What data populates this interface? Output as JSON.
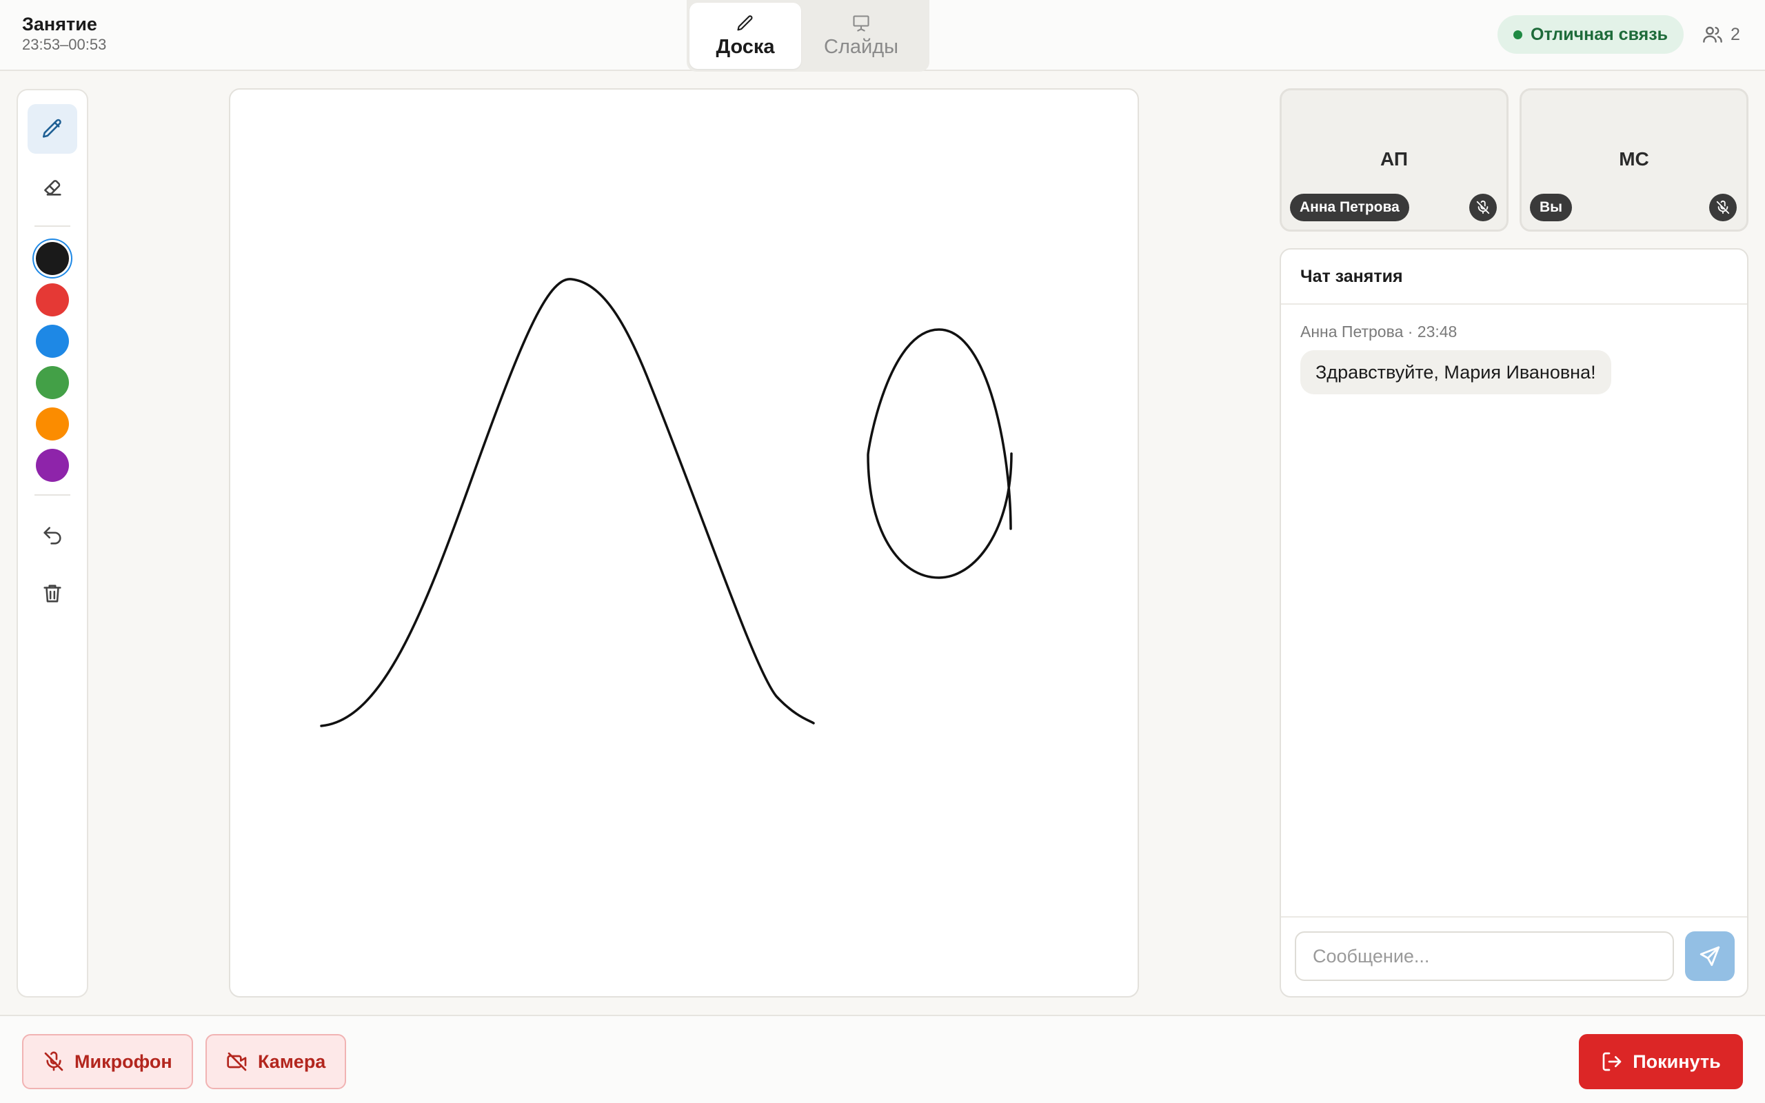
{
  "header": {
    "title": "Занятие",
    "time_range": "23:53–00:53",
    "tabs": [
      {
        "label": "Доска",
        "icon": "pencil-icon",
        "active": true
      },
      {
        "label": "Слайды",
        "icon": "presentation-icon",
        "active": false
      }
    ],
    "connection": {
      "label": "Отличная связь",
      "color": "#1f8a43"
    },
    "participants_count": "2"
  },
  "toolbar": {
    "tools": [
      {
        "name": "pencil",
        "icon": "pencil-icon",
        "active": true
      },
      {
        "name": "eraser",
        "icon": "eraser-icon",
        "active": false
      }
    ],
    "colors": [
      {
        "name": "black",
        "hex": "#1a1a1a",
        "selected": true
      },
      {
        "name": "red",
        "hex": "#e53935",
        "selected": false
      },
      {
        "name": "blue",
        "hex": "#1e88e5",
        "selected": false
      },
      {
        "name": "green",
        "hex": "#43a047",
        "selected": false
      },
      {
        "name": "orange",
        "hex": "#fb8c00",
        "selected": false
      },
      {
        "name": "purple",
        "hex": "#8e24aa",
        "selected": false
      }
    ],
    "actions": [
      {
        "name": "undo",
        "icon": "undo-icon"
      },
      {
        "name": "clear",
        "icon": "trash-icon"
      }
    ]
  },
  "board": {
    "stroke_color": "#111111"
  },
  "tiles": [
    {
      "initials": "АП",
      "name": "Анна Петрова",
      "mic": "muted"
    },
    {
      "initials": "МС",
      "name": "Вы",
      "mic": "muted"
    }
  ],
  "chat": {
    "title": "Чат занятия",
    "messages": [
      {
        "author": "Анна Петрова",
        "time": "23:48",
        "meta": "Анна Петрова · 23:48",
        "text": "Здравствуйте, Мария Ивановна!"
      }
    ],
    "input_placeholder": "Сообщение...",
    "input_value": ""
  },
  "controls": {
    "mic_label": "Микрофон",
    "camera_label": "Камера",
    "leave_label": "Покинуть"
  }
}
